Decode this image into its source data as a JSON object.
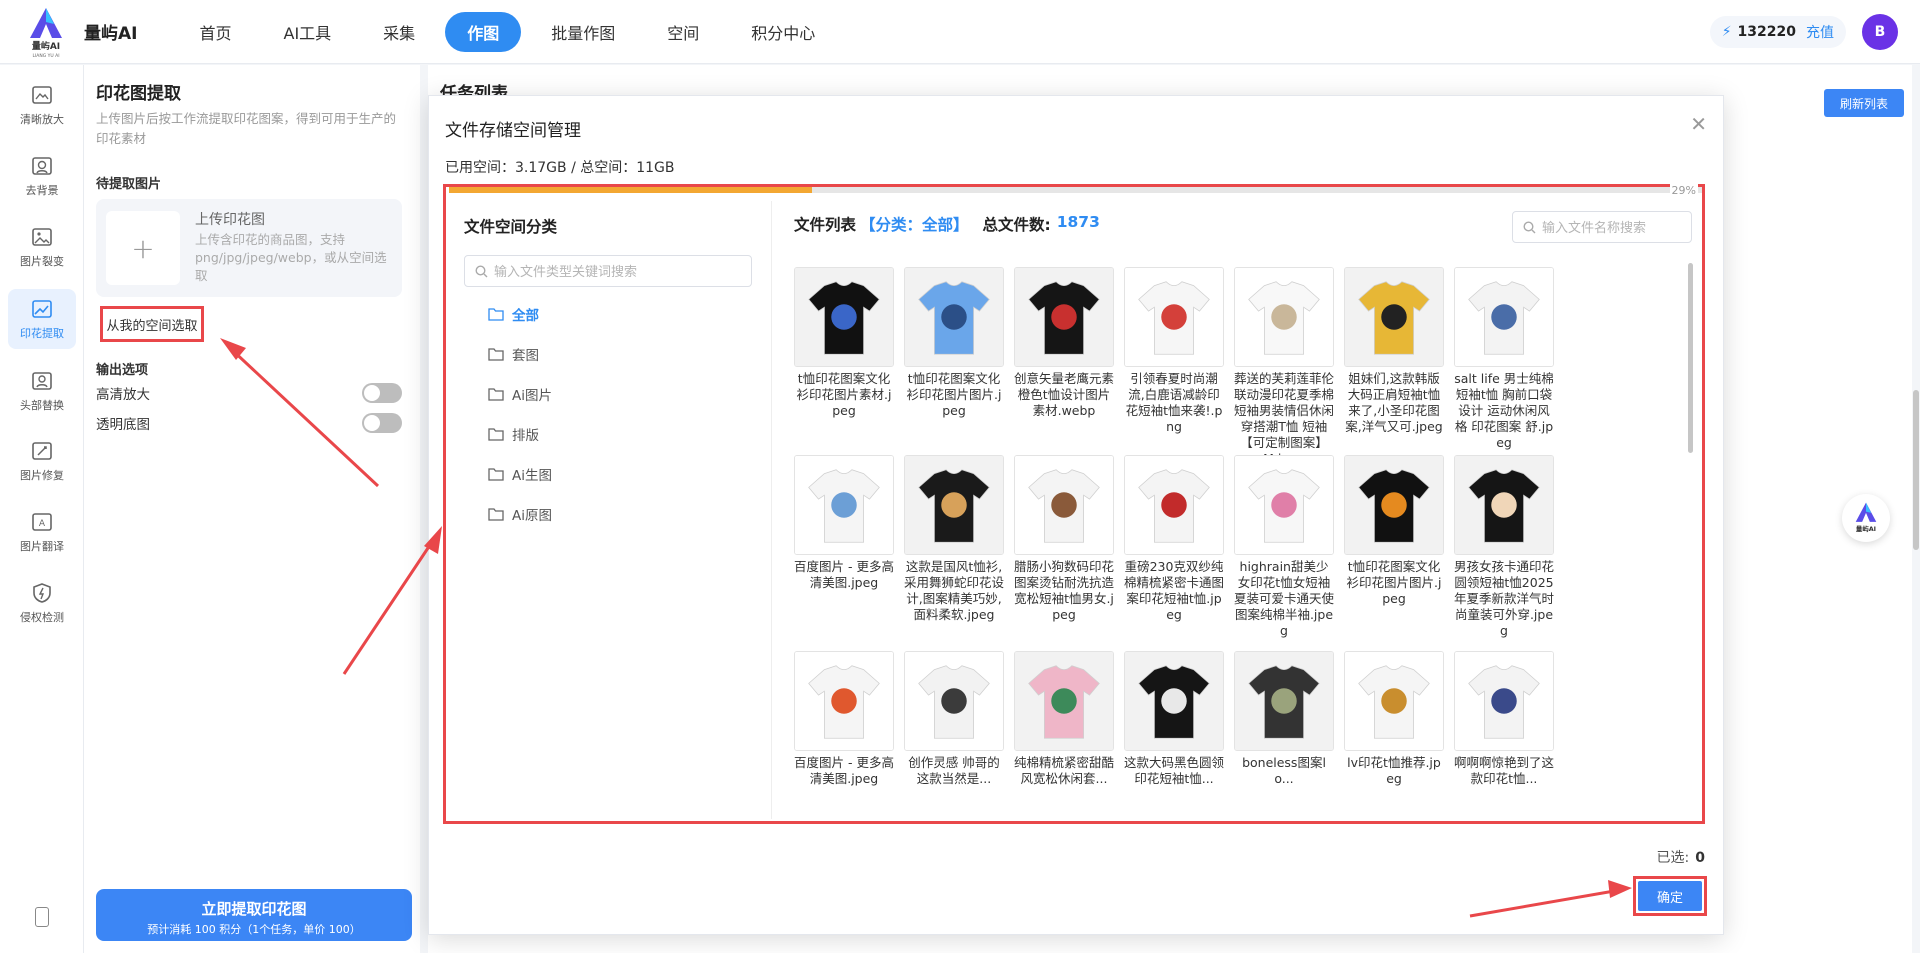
{
  "brand": {
    "name": "量屿AI",
    "logo_text": "量屿AI",
    "logo_sub": "LIANG YU AI"
  },
  "nav": [
    "首页",
    "AI工具",
    "采集",
    "作图",
    "批量作图",
    "空间",
    "积分中心"
  ],
  "nav_active": "作图",
  "account": {
    "points": "132220",
    "recharge_label": "充值",
    "avatar_letter": "B"
  },
  "rail": [
    {
      "label": "清晰放大",
      "icon": "enlarge-icon"
    },
    {
      "label": "去背景",
      "icon": "remove-bg-icon"
    },
    {
      "label": "图片裂变",
      "icon": "image-fission-icon"
    },
    {
      "label": "印花提取",
      "icon": "print-extract-icon",
      "active": true
    },
    {
      "label": "头部替换",
      "icon": "head-swap-icon"
    },
    {
      "label": "图片修复",
      "icon": "image-repair-icon"
    },
    {
      "label": "图片翻译",
      "icon": "image-translate-icon"
    },
    {
      "label": "侵权检测",
      "icon": "infringement-check-icon"
    }
  ],
  "panel": {
    "title": "印花图提取",
    "desc": "上传图片后按工作流提取印花图案，得到可用于生产的印花素材",
    "pending_label": "待提取图片",
    "upload_title": "上传印花图",
    "upload_hint": "上传含印花的商品图，支持png/jpg/jpeg/webp，或从空间选取",
    "space_button": "从我的空间选取",
    "output_label": "输出选项",
    "options": [
      "高清放大",
      "透明底图"
    ],
    "submit_main": "立即提取印花图",
    "submit_sub": "预计消耗 100 积分（1个任务，单价 100）"
  },
  "task": {
    "title": "任务列表",
    "refresh": "刷新列表"
  },
  "modal": {
    "title": "文件存储空间管理",
    "usage": "已用空间：3.17GB / 总空间：11GB",
    "usage_percent": 29,
    "usage_percent_label": "29%",
    "category_title": "文件空间分类",
    "category_search_placeholder": "输入文件类型关键词搜索",
    "categories": [
      "全部",
      "套图",
      "Ai图片",
      "排版",
      "Ai生图",
      "Ai原图"
    ],
    "active_category": "全部",
    "list_title": "文件列表",
    "list_category": "【分类：全部】",
    "total_label": "总文件数:",
    "total_count": "1873",
    "file_search_placeholder": "输入文件名称搜索",
    "files": [
      {
        "name": "t恤印花图案文化衫印花图片素材.jpeg",
        "shirt": "#111111",
        "print": "#3a66c8"
      },
      {
        "name": "t恤印花图案文化衫印花图片图片.jpeg",
        "shirt": "#6aa6ea",
        "print": "#2b4f87"
      },
      {
        "name": "创意矢量老鹰元素橙色t恤设计图片素材.webp",
        "shirt": "#151515",
        "print": "#c8302f"
      },
      {
        "name": "引领春夏时尚潮流,白鹿语减龄印花短袖t恤来袭!.png",
        "shirt": "#f6f6f6",
        "print": "#d4403a"
      },
      {
        "name": "葬送的芙莉莲菲伦联动漫印花夏季棉短袖男装情侣休闲穿搭潮T恤 短袖【可定制图案】 M.jpeg",
        "shirt": "#f8f8f8",
        "print": "#c9b79a"
      },
      {
        "name": "姐妹们,这款韩版大码正肩短袖t恤来了,小圣印花图案,洋气又可.jpeg",
        "shirt": "#e7b736",
        "print": "#222222"
      },
      {
        "name": "salt life 男士纯棉短袖t恤 胸前口袋设计 运动休闲风格 印花图案 舒.jpeg",
        "shirt": "#f3f3f3",
        "print": "#4a6da8"
      },
      {
        "name": "百度图片 - 更多高清美图.jpeg",
        "shirt": "#f5f5f5",
        "print": "#6c9fd6"
      },
      {
        "name": "这款是国风t恤衫,采用舞狮蛇印花设计,图案精美巧妙,面料柔软.jpeg",
        "shirt": "#1a1a1a",
        "print": "#d7a15a"
      },
      {
        "name": "腊肠小狗数码印花图案烫钻耐洗抗造宽松短袖t恤男女.jpeg",
        "shirt": "#f4f4f4",
        "print": "#8a5a3a"
      },
      {
        "name": "重磅230克双纱纯棉精梳紧密卡通图案印花短袖t恤.jpeg",
        "shirt": "#f4f4f4",
        "print": "#c22b2b"
      },
      {
        "name": "highrain甜美少女印花t恤女短袖夏装可爱卡通天使图案纯棉半袖.jpeg",
        "shirt": "#f7f7f7",
        "print": "#e07fa8"
      },
      {
        "name": "t恤印花图案文化衫印花图片图片.jpeg",
        "shirt": "#111111",
        "print": "#e58a1f"
      },
      {
        "name": "男孩女孩卡通印花圆领短袖t恤2025年夏季新款洋气时尚童装可外穿.jpeg",
        "shirt": "#151515",
        "print": "#f0d6b8"
      },
      {
        "name": "百度图片 - 更多高清美图.jpeg",
        "shirt": "#f5f5f5",
        "print": "#e0582e"
      },
      {
        "name": "创作灵感 帅哥的这款当然是...",
        "shirt": "#f2f2f2",
        "print": "#3b3b3b"
      },
      {
        "name": "纯棉精梳紧密甜酷风宽松休闲套...",
        "shirt": "#efb6c8",
        "print": "#3d8a5a"
      },
      {
        "name": "这款大码黑色圆领印花短袖t恤...",
        "shirt": "#151515",
        "print": "#e8e8e8"
      },
      {
        "name": "boneless图案lo...",
        "shirt": "#333333",
        "print": "#9aa37c"
      },
      {
        "name": "lv印花t恤推荐.jpeg",
        "shirt": "#f5f5f5",
        "print": "#c98e2e"
      },
      {
        "name": "啊啊啊惊艳到了这款印花t恤...",
        "shirt": "#f3f3f3",
        "print": "#3a4a8a"
      }
    ],
    "selected_label": "已选:",
    "selected_count": "0",
    "confirm": "确定"
  },
  "colors": {
    "accent": "#2f8cf2",
    "annotation": "#e9474a",
    "progress": "#f3a732"
  }
}
